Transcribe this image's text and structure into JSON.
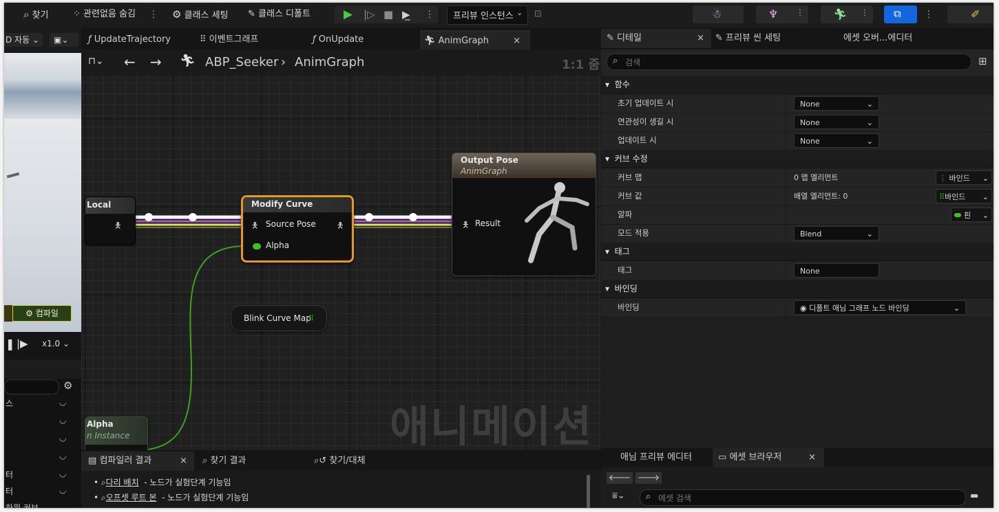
{
  "toolbar": {
    "find": "찾기",
    "hide_unrelated": "관련없음 숨김",
    "class_settings": "클래스 세팅",
    "class_defaults": "클래스 디폴트",
    "preview_instance": "프리뷰 인스턴스"
  },
  "viewport": {
    "lod": "D 자동",
    "compile": "컴파일",
    "speed": "x1.0",
    "list_labels": [
      "스",
      "터",
      "터",
      "하위 커브"
    ]
  },
  "graph_tabs": {
    "tabs": [
      "UpdateTrajectory",
      "이벤트그래프",
      "OnUpdate",
      "AnimGraph"
    ]
  },
  "breadcrumb": {
    "asset": "ABP_Seeker",
    "graph": "AnimGraph",
    "zoom": "1:1 줌"
  },
  "nodes": {
    "local_title": "Local",
    "modify_curve_title": "Modify Curve",
    "source_pose": "Source Pose",
    "alpha": "Alpha",
    "output_title": "Output Pose",
    "output_subtitle": "AnimGraph",
    "result": "Result",
    "blink": "Blink Curve Map",
    "alpha_node_title": "Alpha",
    "alpha_node_subtitle": "n Instance"
  },
  "watermark": "애니메이션",
  "results": {
    "tabs": [
      "컴파일러 결과",
      "찾기 결과",
      "찾기/대체"
    ],
    "lines": [
      {
        "link": "다리 배치",
        "text": "- 노드가 실험단계 기능임"
      },
      {
        "link": "오프셋 루트 본",
        "text": "- 노드가 실험단계 기능임"
      }
    ]
  },
  "details": {
    "tabs": [
      "디테일",
      "프리뷰 씬 세팅",
      "에셋 오버...에디터"
    ],
    "search_placeholder": "검색",
    "categories": {
      "function": "함수",
      "modify_curve": "커브 수정",
      "tag": "태그",
      "binding": "바인딩"
    },
    "rows": {
      "initial_update": "초기 업데이트 시",
      "become_relevant": "연관성이 생길 시",
      "on_update": "업데이트 시",
      "curve_map": "커브 맵",
      "curve_values": "커브 값",
      "alpha": "알파",
      "apply_mode": "모드 적용",
      "tag": "태그",
      "binding": "바인딩"
    },
    "values": {
      "none1": "None",
      "none2": "None",
      "none3": "None",
      "curve_map_value": "0 맵 엘리먼트",
      "curve_values_value": "배열 엘리먼트: 0",
      "bind": "바인드",
      "pin": "핀",
      "apply_mode_value": "Blend",
      "tag_value": "None",
      "binding_value": "디폴트 애님 그래프 노드 바인딩"
    }
  },
  "bottom_panel": {
    "tabs": [
      "애님 프리뷰 에디터",
      "에셋 브라우저"
    ],
    "search_placeholder": "에셋 검색"
  },
  "colors": {
    "accent_green": "#4ec62b",
    "node_selected_border": "#e89a14",
    "exec_blue": "#1a7cff"
  }
}
